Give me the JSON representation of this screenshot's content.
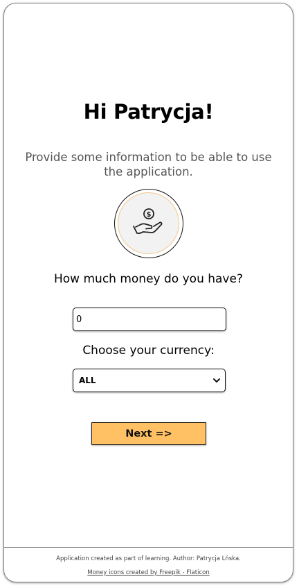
{
  "greeting": "Hi Patrycja!",
  "subtitle": "Provide some information to be able to use the application.",
  "icon": "money-hand-icon",
  "money": {
    "question": "How much money do you have?",
    "value": "0"
  },
  "currency": {
    "label": "Choose your currency:",
    "selected": "ALL"
  },
  "next_button": "Next =>",
  "footer": {
    "credit": "Application created as part of learning. Author: Patrycja Lńska.",
    "link": "Money icons created by Freepik - Flaticon"
  },
  "colors": {
    "button": "#ffc163",
    "icon_ring": "#f3c78a",
    "subtitle": "#555555"
  }
}
